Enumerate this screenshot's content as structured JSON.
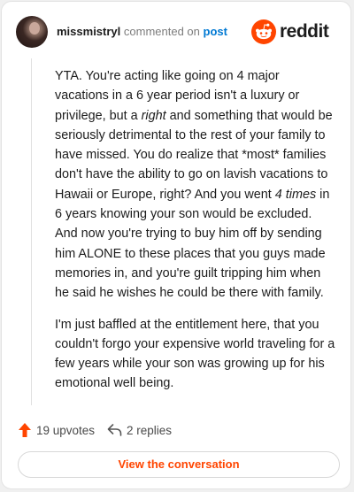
{
  "header": {
    "username": "missmistryl",
    "commented_on": "commented on",
    "post_link": "post",
    "brand": "reddit",
    "brand_color": "#ff4500"
  },
  "comment": {
    "paragraphs": [
      [
        {
          "text": "YTA. You're acting like going on 4 major vacations in a 6 year period isn't a luxury or privilege, but a "
        },
        {
          "text": "right",
          "italic": true
        },
        {
          "text": " and something that would be seriously detrimental to the rest of your family to have missed. You do realize that *most* families don't have the ability to go on lavish vacations to Hawaii or Europe, right? And you went "
        },
        {
          "text": "4 times",
          "italic": true
        },
        {
          "text": " in 6 years knowing your son would be excluded. And now you're trying to buy him off by sending him ALONE to these places that you guys made memories in, and you're guilt tripping him when he said he wishes he could be there with family."
        }
      ],
      [
        {
          "text": "I'm just baffled at the entitlement here, that you couldn't forgo your expensive world traveling for a few years while your son was growing up for his emotional well being."
        }
      ]
    ]
  },
  "actions": {
    "upvotes": "19 upvotes",
    "replies": "2 replies",
    "upvote_icon_color": "#ff4500"
  },
  "cta": {
    "label": "View the conversation",
    "color": "#ff4500"
  }
}
